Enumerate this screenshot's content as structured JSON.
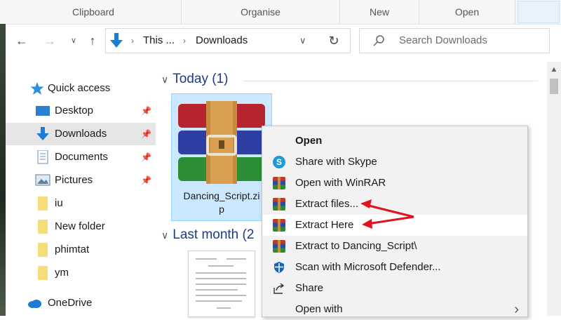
{
  "ribbon": {
    "groups": [
      "Clipboard",
      "Organise",
      "New",
      "Open"
    ]
  },
  "address": {
    "crumbs": [
      "This ...",
      "Downloads"
    ]
  },
  "search": {
    "placeholder": "Search Downloads"
  },
  "nav": {
    "items": [
      {
        "label": "Quick access",
        "icon": "star-icon"
      },
      {
        "label": "Desktop",
        "icon": "desktop-icon",
        "pinned": true
      },
      {
        "label": "Downloads",
        "icon": "download-arrow-icon",
        "pinned": true,
        "selected": true
      },
      {
        "label": "Documents",
        "icon": "documents-icon",
        "pinned": true
      },
      {
        "label": "Pictures",
        "icon": "pictures-icon",
        "pinned": true
      },
      {
        "label": "iu",
        "icon": "folder-icon"
      },
      {
        "label": "New folder",
        "icon": "folder-icon"
      },
      {
        "label": "phimtat",
        "icon": "folder-icon"
      },
      {
        "label": "ym",
        "icon": "folder-icon"
      },
      {
        "label": "OneDrive",
        "icon": "cloud-icon"
      }
    ]
  },
  "content": {
    "groups": [
      {
        "label": "Today (1)"
      },
      {
        "label": "Last month (2"
      }
    ],
    "files": [
      {
        "name": "Dancing_Script.zip",
        "name_display": [
          "Dancing_Script.zi",
          "p"
        ],
        "icon": "winrar-archive-icon",
        "selected": true
      }
    ]
  },
  "context_menu": {
    "items": [
      {
        "label": "Open",
        "bold": true,
        "icon": ""
      },
      {
        "label": "Share with Skype",
        "icon": "skype-icon"
      },
      {
        "label": "Open with WinRAR",
        "icon": "winrar-icon"
      },
      {
        "label": "Extract files...",
        "icon": "winrar-icon",
        "annotated": true
      },
      {
        "label": "Extract Here",
        "icon": "winrar-icon",
        "highlighted": true,
        "annotated": true
      },
      {
        "label": "Extract to Dancing_Script\\",
        "icon": "winrar-icon"
      },
      {
        "label": "Scan with Microsoft Defender...",
        "icon": "defender-shield-icon"
      },
      {
        "label": "Share",
        "icon": "share-icon"
      },
      {
        "label": "Open with",
        "icon": "",
        "submenu": true
      }
    ]
  },
  "colors": {
    "accent": "#0078d7",
    "selection": "#cce8ff",
    "annotation_arrow": "#e0141e",
    "group_header": "#1e3a8a"
  }
}
